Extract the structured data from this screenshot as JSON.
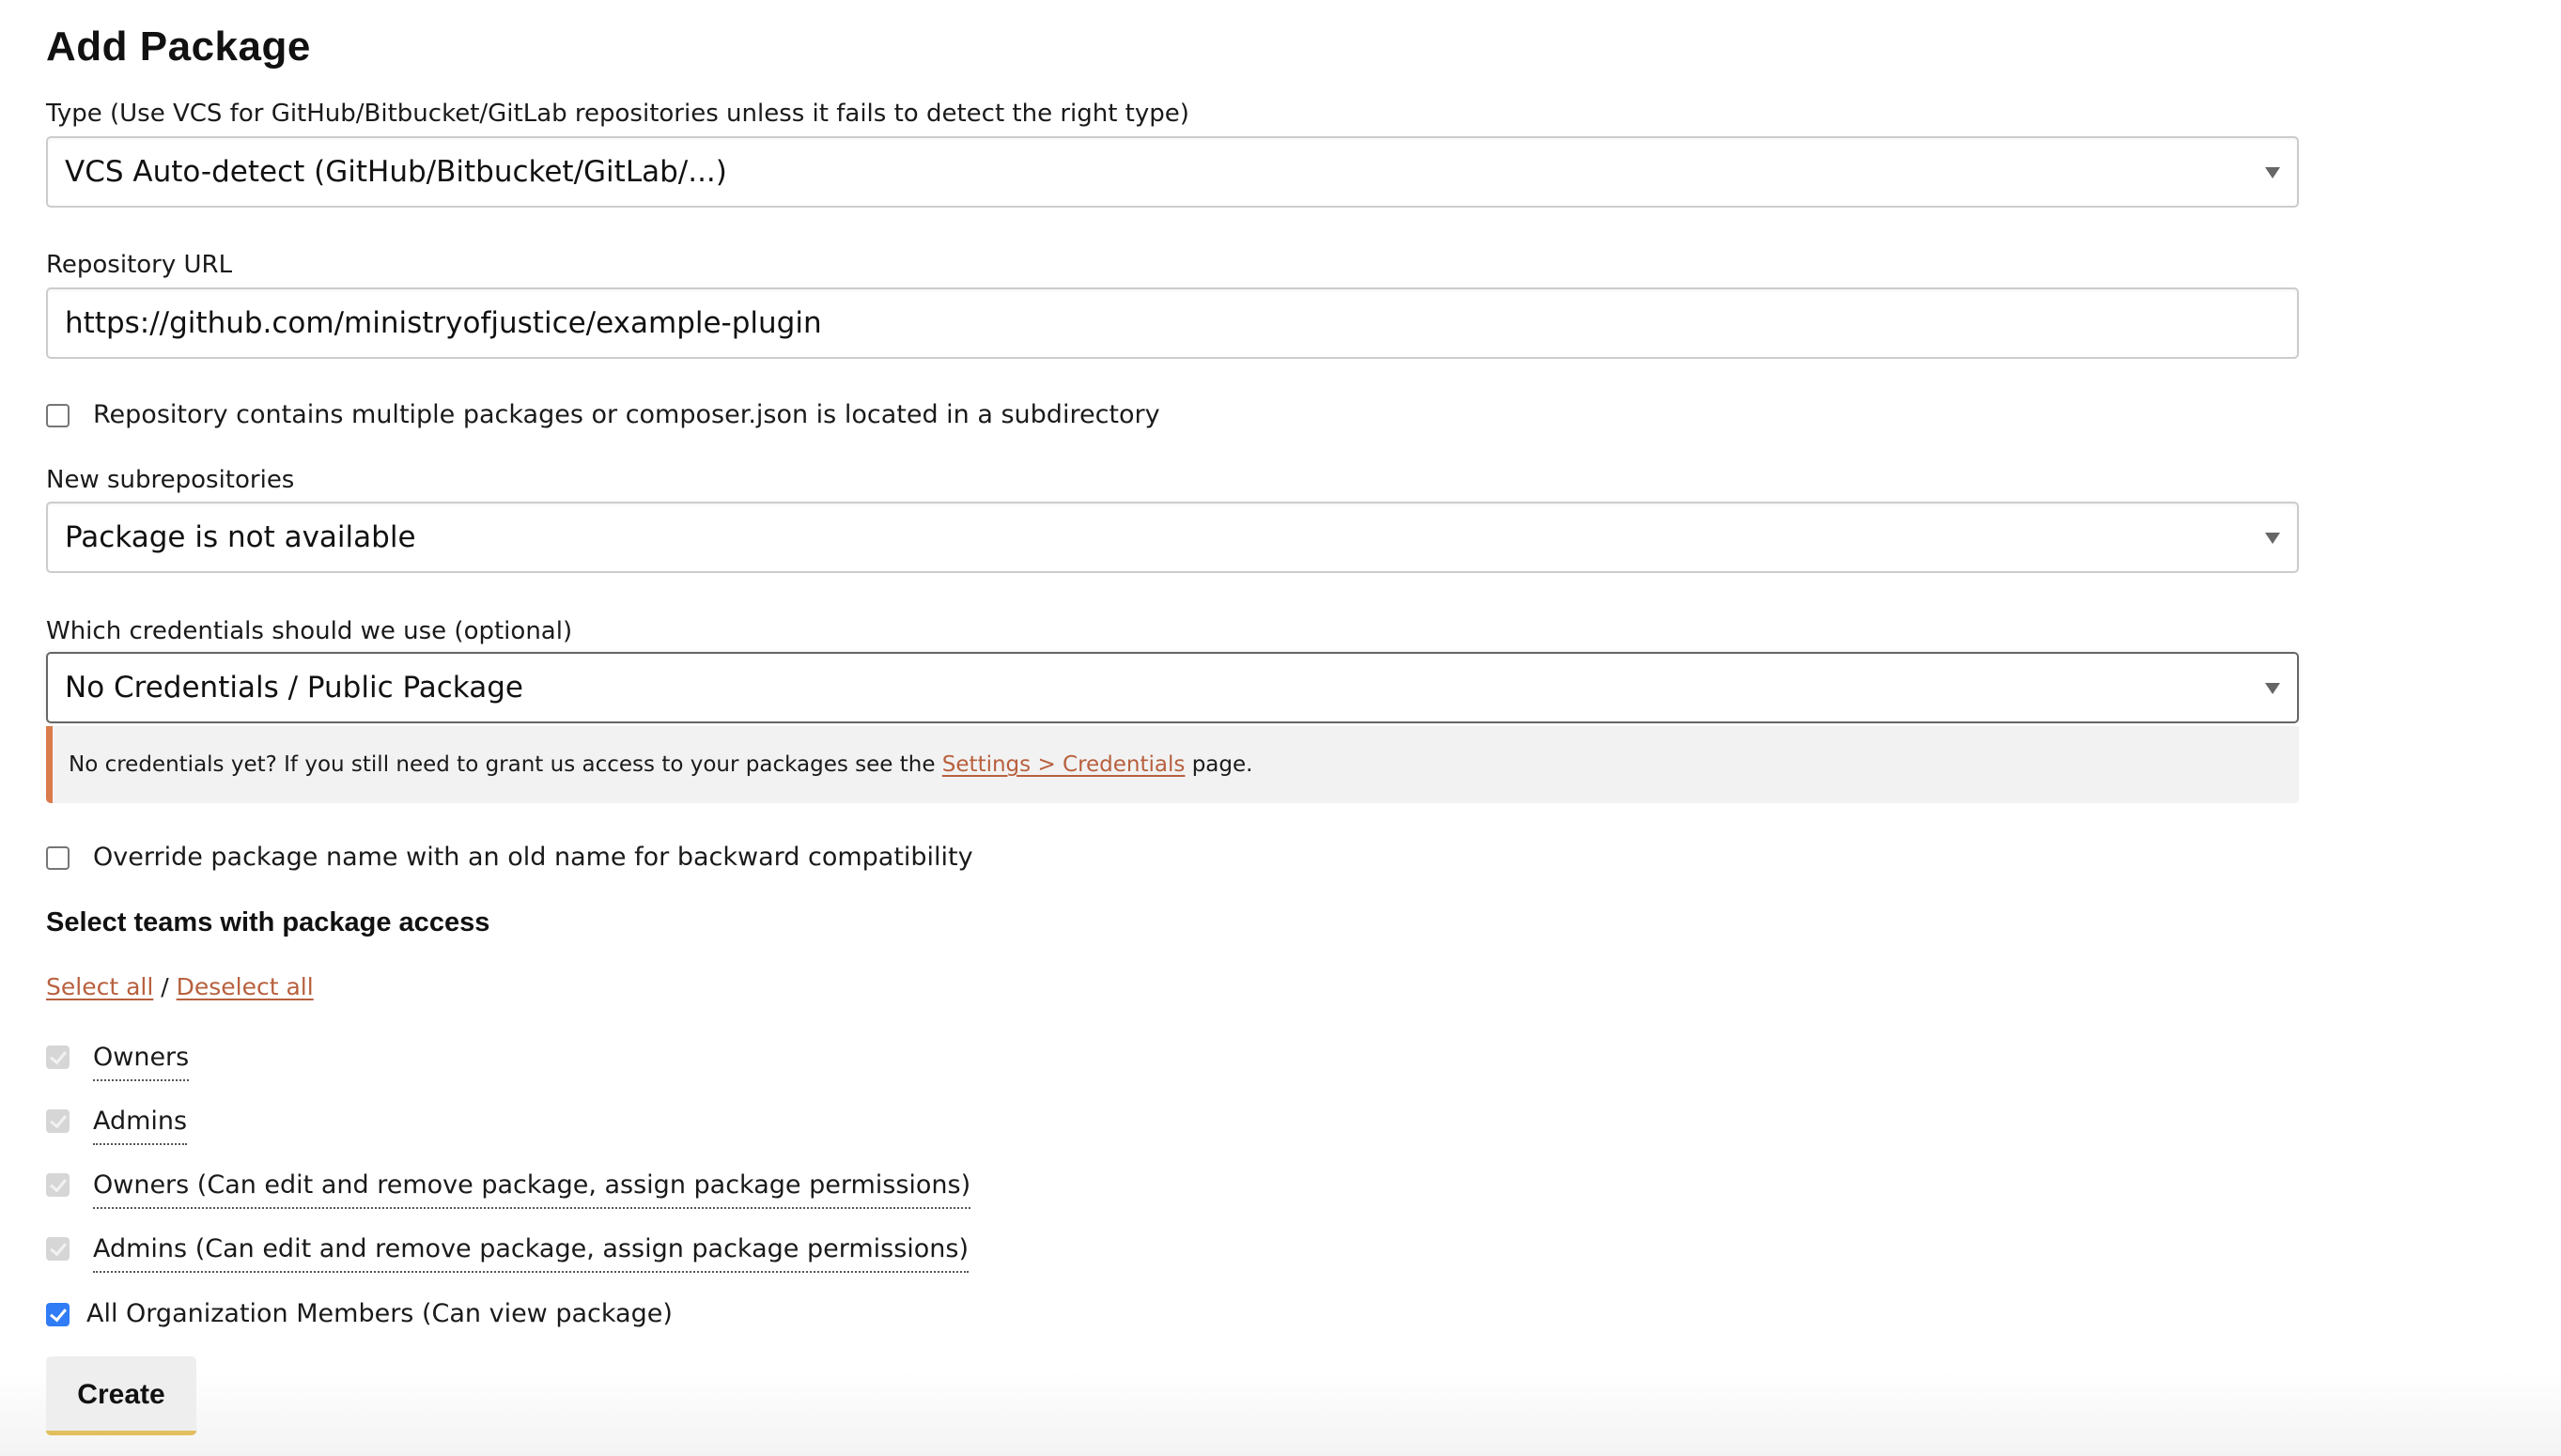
{
  "page": {
    "title": "Add Package"
  },
  "form": {
    "type": {
      "label": "Type (Use VCS for GitHub/Bitbucket/GitLab repositories unless it fails to detect the right type)",
      "selected": "VCS Auto-detect (GitHub/Bitbucket/GitLab/...)"
    },
    "repository_url": {
      "label": "Repository URL",
      "value": "https://github.com/ministryofjustice/example-plugin"
    },
    "multiple_packages": {
      "label": "Repository contains multiple packages or composer.json is located in a subdirectory",
      "checked": false
    },
    "new_subrepositories": {
      "label": "New subrepositories",
      "selected": "Package is not available"
    },
    "credentials": {
      "label": "Which credentials should we use (optional)",
      "selected": "No Credentials / Public Package",
      "notice": {
        "text_before": "No credentials yet? If you still need to grant us access to your packages see the ",
        "link_text": "Settings > Credentials",
        "text_after": " page."
      }
    },
    "override_name": {
      "label": "Override package name with an old name for backward compatibility",
      "checked": false
    },
    "teams": {
      "heading": "Select teams with package access",
      "select_all": "Select all",
      "separator": " / ",
      "deselect_all": "Deselect all",
      "items": [
        {
          "label": "Owners",
          "checked": true,
          "disabled": true
        },
        {
          "label": "Admins",
          "checked": true,
          "disabled": true
        },
        {
          "label": "Owners (Can edit and remove package, assign package permissions)",
          "checked": true,
          "disabled": true
        },
        {
          "label": "Admins (Can edit and remove package, assign package permissions)",
          "checked": true,
          "disabled": true
        },
        {
          "label": "All Organization Members (Can view package)",
          "checked": true,
          "disabled": false
        }
      ]
    },
    "submit_label": "Create"
  },
  "colors": {
    "link": "#b8603e",
    "alert_accent": "#d97b4a",
    "button_accent": "#e2be5e",
    "checkbox_checked": "#2f7cf6"
  }
}
